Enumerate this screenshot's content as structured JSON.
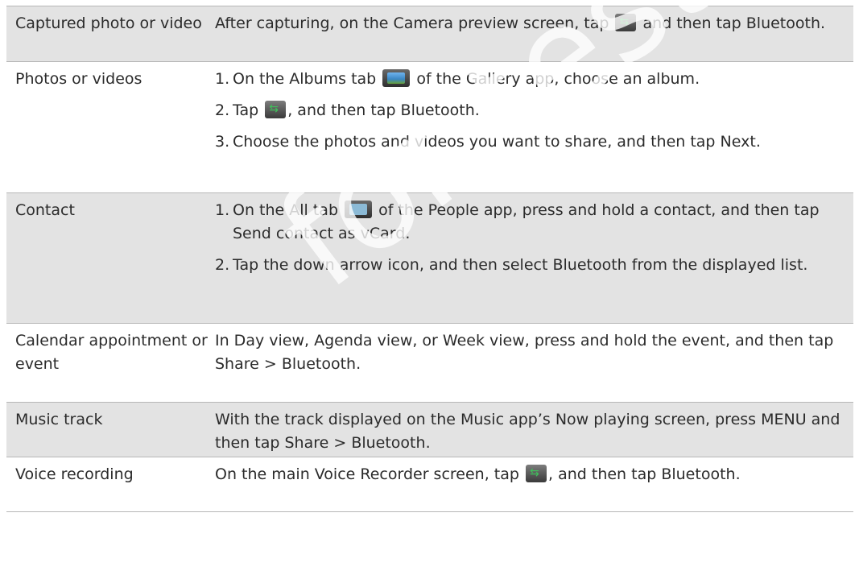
{
  "rows": [
    {
      "label": "Captured photo or video",
      "segments": [
        "After capturing, on the Camera preview screen, tap ",
        " and then tap ",
        "Bluetooth",
        "."
      ]
    },
    {
      "label": "Photos or videos",
      "items": [
        {
          "num": "1.",
          "a": "On the Albums tab ",
          "b": " of the Gallery app, choose an album."
        },
        {
          "num": "2.",
          "a": "Tap ",
          "b": ", and then tap ",
          "c": "Bluetooth",
          "d": "."
        },
        {
          "num": "3.",
          "a": "Choose the photos and videos you want to share, and then tap ",
          "b": "Next",
          "c": "."
        }
      ]
    },
    {
      "label": "Contact",
      "items": [
        {
          "num": "1.",
          "a": "On the All tab ",
          "b": " of the People app, press and hold a contact, and then tap ",
          "c": "Send contact as vCard",
          "d": "."
        },
        {
          "num": "2.",
          "a": "Tap the down arrow icon, and then select ",
          "b": "Bluetooth",
          "c": " from the displayed list."
        }
      ]
    },
    {
      "label": "Calendar appointment or event",
      "segments": [
        "In Day view, Agenda view, or Week view, press and hold the event, and then tap ",
        "Share",
        " > ",
        "Bluetooth",
        "."
      ]
    },
    {
      "label": "Music track",
      "segments": [
        "With the track displayed on the Music app’s Now playing screen, press MENU and then tap ",
        "Share",
        " > ",
        "Bluetooth",
        "."
      ]
    },
    {
      "label": "Voice recording",
      "segments": [
        "On the main Voice Recorder screen, tap ",
        ", and then tap ",
        "Bluetooth",
        "."
      ]
    }
  ],
  "watermark": "for test review",
  "icons": [
    "share-icon",
    "albums-tab-icon",
    "people-all-tab-icon"
  ]
}
